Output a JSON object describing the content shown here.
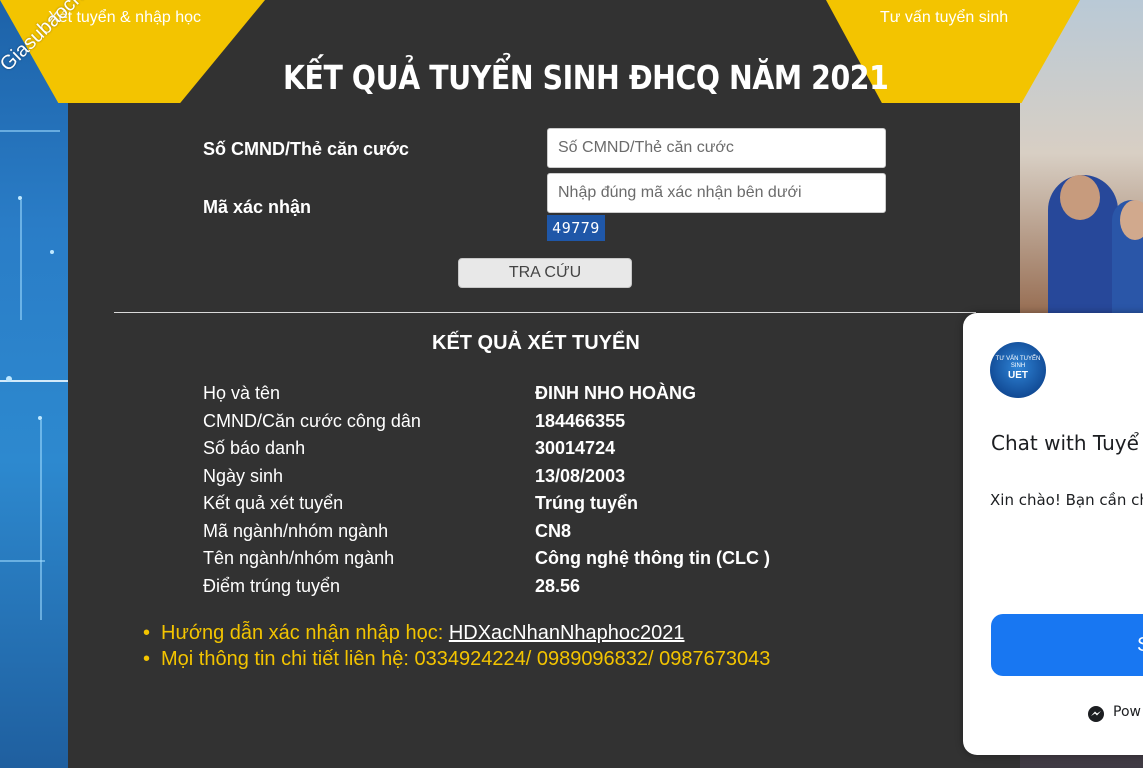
{
  "nav": {
    "left_tab": "Xét tuyển & nhập học",
    "right_tab": "Tư vấn tuyển sinh"
  },
  "watermark": "Giasubaochau.net",
  "page_title": "KẾT QUẢ TUYỂN SINH ĐHCQ NĂM 2021",
  "form": {
    "id_label": "Số CMND/Thẻ căn cước",
    "id_placeholder": "Số CMND/Thẻ căn cước",
    "captcha_label": "Mã xác nhận",
    "captcha_placeholder": "Nhập đúng mã xác nhận bên dưới",
    "captcha_code": "49779",
    "search_button": "TRA CỨU"
  },
  "result": {
    "heading": "KẾT QUẢ XÉT TUYỂN",
    "rows": [
      {
        "label": "Họ và tên",
        "value": "ĐINH NHO HOÀNG"
      },
      {
        "label": "CMND/Căn cước công dân",
        "value": "184466355"
      },
      {
        "label": "Số báo danh",
        "value": "30014724"
      },
      {
        "label": "Ngày sinh",
        "value": "13/08/2003"
      },
      {
        "label": "Kết quả xét tuyển",
        "value": "Trúng tuyển"
      },
      {
        "label": "Mã ngành/nhóm ngành",
        "value": "CN8"
      },
      {
        "label": "Tên ngành/nhóm ngành",
        "value": "Công nghệ thông tin (CLC )"
      },
      {
        "label": "Điểm trúng tuyển",
        "value": "28.56"
      }
    ]
  },
  "notes": {
    "guide_prefix": "Hướng dẫn xác nhận nhập học: ",
    "guide_link": "HDXacNhanNhaphoc2021",
    "contact": "Mọi thông tin chi tiết liên hệ: 0334924224/ 0989096832/ 0987673043"
  },
  "chat": {
    "avatar_line1": "TƯ VẤN TUYỂN SINH",
    "avatar_line2": "UET",
    "title": "Chat with Tuyể",
    "greeting": "Xin chào! Bạn cần ch",
    "button": "S",
    "footer": "Pow"
  },
  "colors": {
    "panel_bg": "#323232",
    "accent_yellow": "#f3c400",
    "captcha_bg": "#1f57a8",
    "messenger_blue": "#1877f2"
  }
}
